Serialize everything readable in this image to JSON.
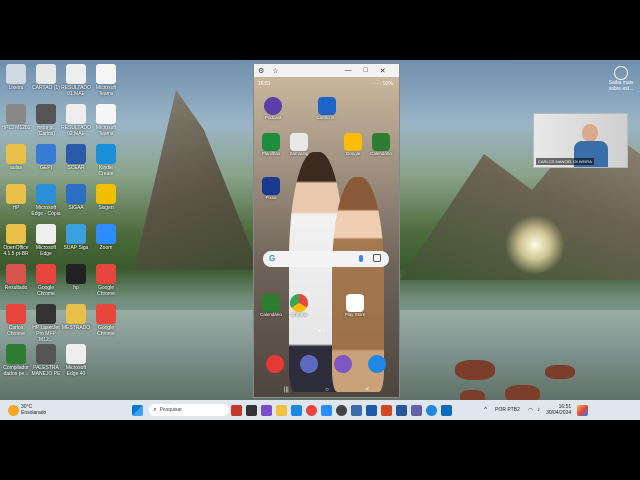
{
  "desktop": {
    "icons": [
      {
        "label": "Lixeira",
        "color": "#cfd8e3"
      },
      {
        "label": "CARTAO (1)",
        "color": "#e8e8e8"
      },
      {
        "label": "RESULTADO 01 MAE",
        "color": "#eeeeee"
      },
      {
        "label": "Microsoft Teams",
        "color": "#f5f5f5"
      },
      {
        "label": "HPLJ M1201",
        "color": "#888888"
      },
      {
        "label": "fotos pc (Carlos)",
        "color": "#555555"
      },
      {
        "label": "RESULTADO 02 MAE",
        "color": "#eeeeee"
      },
      {
        "label": "Microsoft Teams",
        "color": "#f5f5f5"
      },
      {
        "label": "aulas",
        "color": "#e8c04a"
      },
      {
        "label": "GEPI",
        "color": "#3a7bd5"
      },
      {
        "label": "SCEAR",
        "color": "#2b5aa8"
      },
      {
        "label": "Kindle Create",
        "color": "#1a90d9"
      },
      {
        "label": "HP",
        "color": "#e8c04a"
      },
      {
        "label": "Microsoft Edge - Cópia",
        "color": "#2a8fd6"
      },
      {
        "label": "SIGAA",
        "color": "#2a6fc4"
      },
      {
        "label": "Sisgen",
        "color": "#f0c000"
      },
      {
        "label": "OpenOffice 4.1.5 pt-BR",
        "color": "#e8c04a"
      },
      {
        "label": "Microsoft Edge",
        "color": "#eeeeee"
      },
      {
        "label": "SUAP Siga",
        "color": "#3aa0e0"
      },
      {
        "label": "Zoom",
        "color": "#2d8cff"
      },
      {
        "label": "Resultado",
        "color": "#d9534f"
      },
      {
        "label": "Google Chrome",
        "color": "#e8453c"
      },
      {
        "label": "hp",
        "color": "#222222"
      },
      {
        "label": "Google Chrome",
        "color": "#e8453c"
      },
      {
        "label": "Carlos Chrome",
        "color": "#e8453c"
      },
      {
        "label": "HP LaserJet Pro MFP M12...",
        "color": "#333333"
      },
      {
        "label": "MESTRADO",
        "color": "#e8c04a"
      },
      {
        "label": "Google Chrome",
        "color": "#e8453c"
      },
      {
        "label": "Compilador dados pe...",
        "color": "#2e7d32"
      },
      {
        "label": "PALESTRA MANEJO PE",
        "color": "#555555"
      },
      {
        "label": "Microsoft Edge 40",
        "color": "#eeeeee"
      }
    ],
    "right_icon_label": "Saiba mais sobre est..."
  },
  "phone_window": {
    "title_controls": [
      "⚙",
      "☆",
      "—",
      "□",
      "✕"
    ],
    "status_time": "16:51",
    "status_right": "◦ ◦ ◦ 92%",
    "apps_row1": [
      {
        "label": "Podcast",
        "color": "#5a3fa8"
      },
      {
        "label": "Cartão S...",
        "color": "#1d64c8"
      }
    ],
    "apps_row2": [
      {
        "label": "Planilhas",
        "color": "#1e8e3e"
      },
      {
        "label": "Samsung",
        "color": "#e8e8e8"
      },
      {
        "label": "Google",
        "color": "#fbbc05"
      },
      {
        "label": "Calendário",
        "color": "#2e7d32"
      }
    ],
    "apps_row3": [
      {
        "label": "Pixsa",
        "color": "#1a3a8f"
      }
    ],
    "search_letter": "G",
    "dock_row": [
      {
        "label": "Calendário",
        "color": "#2e7d32"
      },
      {
        "label": "Chrome",
        "color": "#e8453c"
      },
      {
        "label": "Play Store",
        "color": "#ffffff"
      }
    ],
    "bottom_row": [
      {
        "label": "",
        "color": "#e53935"
      },
      {
        "label": "",
        "color": "#5c6bc0"
      },
      {
        "label": "",
        "color": "#7e57c2"
      },
      {
        "label": "",
        "color": "#1e88e5"
      }
    ],
    "nav": [
      "|||",
      "○",
      "<"
    ]
  },
  "webcam": {
    "name_label": "CARLOS MANOEL OLIVEIRA"
  },
  "taskbar": {
    "weather_temp": "30°C",
    "weather_desc": "Ensolarado",
    "search_placeholder": "Pesquisar",
    "lang": "POR PTB2",
    "time": "16:51",
    "date": "30/04/2024"
  }
}
